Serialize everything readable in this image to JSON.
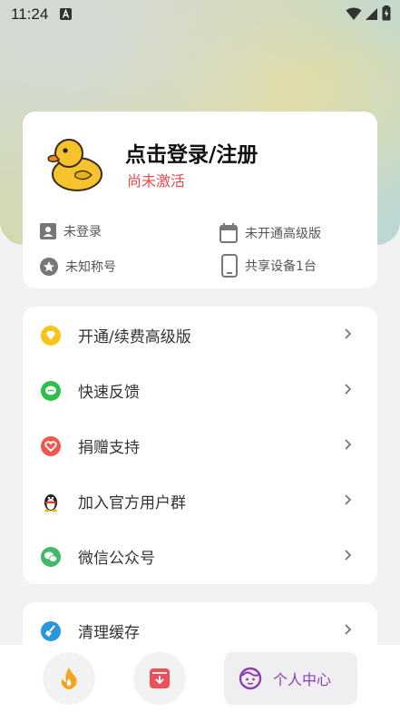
{
  "status_bar": {
    "time": "11:24"
  },
  "profile": {
    "login_title": "点击登录/注册",
    "activation_status": "尚未激活",
    "login_state": "未登录",
    "nickname": "未知称号",
    "subscription": "未开通高级版",
    "devices": "共享设备1台"
  },
  "menu": {
    "items": [
      {
        "label": "开通/续费高级版",
        "icon": "diamond-icon"
      },
      {
        "label": "快速反馈",
        "icon": "chat-icon"
      },
      {
        "label": "捐赠支持",
        "icon": "heart-icon"
      },
      {
        "label": "加入官方用户群",
        "icon": "qq-penguin-icon"
      },
      {
        "label": "微信公众号",
        "icon": "wechat-icon"
      },
      {
        "label": "清理缓存",
        "icon": "broom-icon"
      }
    ]
  },
  "bottom_nav": {
    "items": [
      {
        "icon": "flame-icon"
      },
      {
        "icon": "download-box-icon"
      },
      {
        "icon": "face-icon",
        "label": "个人中心",
        "active": true
      }
    ]
  },
  "colors": {
    "accent_red": "#e94a4a",
    "active_purple": "#8e3cb5",
    "diamond": "#f5c518",
    "chat": "#2fbe4a",
    "heart": "#f0584b",
    "wechat": "#43b96a",
    "broom": "#2a97dc"
  }
}
